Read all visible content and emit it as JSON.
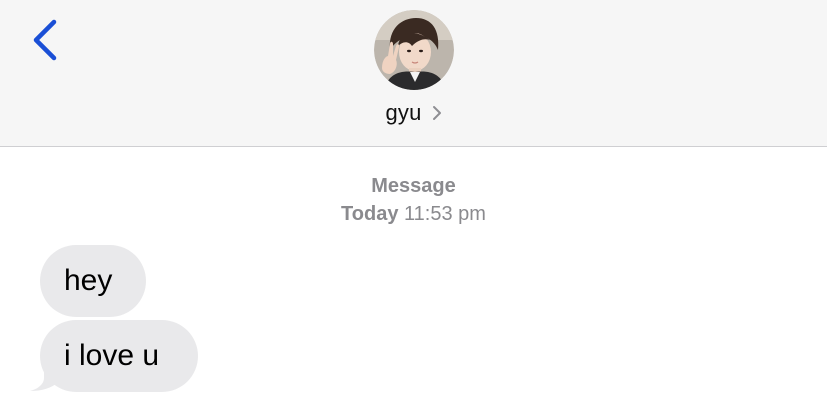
{
  "header": {
    "contact_name": "gyu",
    "back_icon": "chevron-left-icon",
    "avatar_label": "contact photo",
    "accent_color": "#1a4fd6"
  },
  "thread": {
    "service_label": "Message",
    "day_label": "Today",
    "time_label": "11:53 pm"
  },
  "messages": [
    {
      "text": "hey",
      "direction": "incoming"
    },
    {
      "text": "i love u",
      "direction": "incoming"
    }
  ],
  "colors": {
    "header_bg": "#f6f6f6",
    "bubble_bg": "#e9e9eb",
    "meta_text": "#8a8a8e"
  }
}
